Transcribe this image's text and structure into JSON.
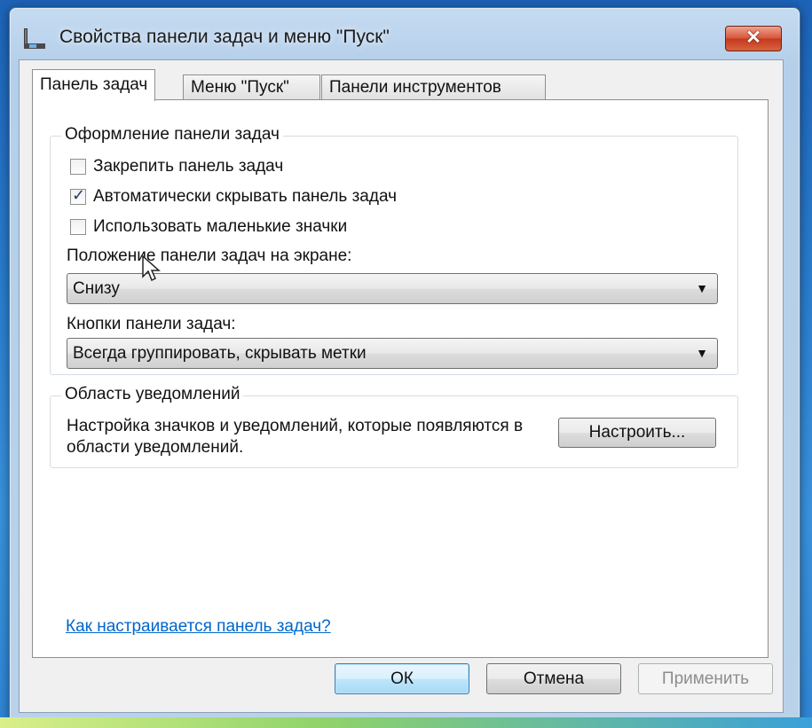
{
  "window": {
    "title": "Свойства панели задач и меню \"Пуск\"",
    "close_label": "✕"
  },
  "tabs": [
    {
      "label": "Панель задач",
      "active": true
    },
    {
      "label": "Меню \"Пуск\"",
      "active": false
    },
    {
      "label": "Панели инструментов",
      "active": false
    }
  ],
  "appearance": {
    "legend": "Оформление панели задач",
    "checkboxes": [
      {
        "label": "Закрепить панель задач",
        "checked": false
      },
      {
        "label": "Автоматически скрывать панель задач",
        "checked": true
      },
      {
        "label": "Использовать маленькие значки",
        "checked": false
      }
    ],
    "position_label": "Положение панели задач на экране:",
    "position_value": "Снизу",
    "buttons_label": "Кнопки панели задач:",
    "buttons_value": "Всегда группировать, скрывать метки"
  },
  "notifications": {
    "legend": "Область уведомлений",
    "description": "Настройка значков и уведомлений, которые появляются в области уведомлений.",
    "customize_label": "Настроить..."
  },
  "help_link": "Как настраивается панель задач?",
  "footer": {
    "ok_label": "ОК",
    "cancel_label": "Отмена",
    "apply_label": "Применить"
  },
  "icons": {
    "window_icon": "taskbar-properties-icon",
    "combo_arrow": "chevron-down-icon",
    "check": "checkmark-icon",
    "cursor": "mouse-pointer-icon"
  }
}
